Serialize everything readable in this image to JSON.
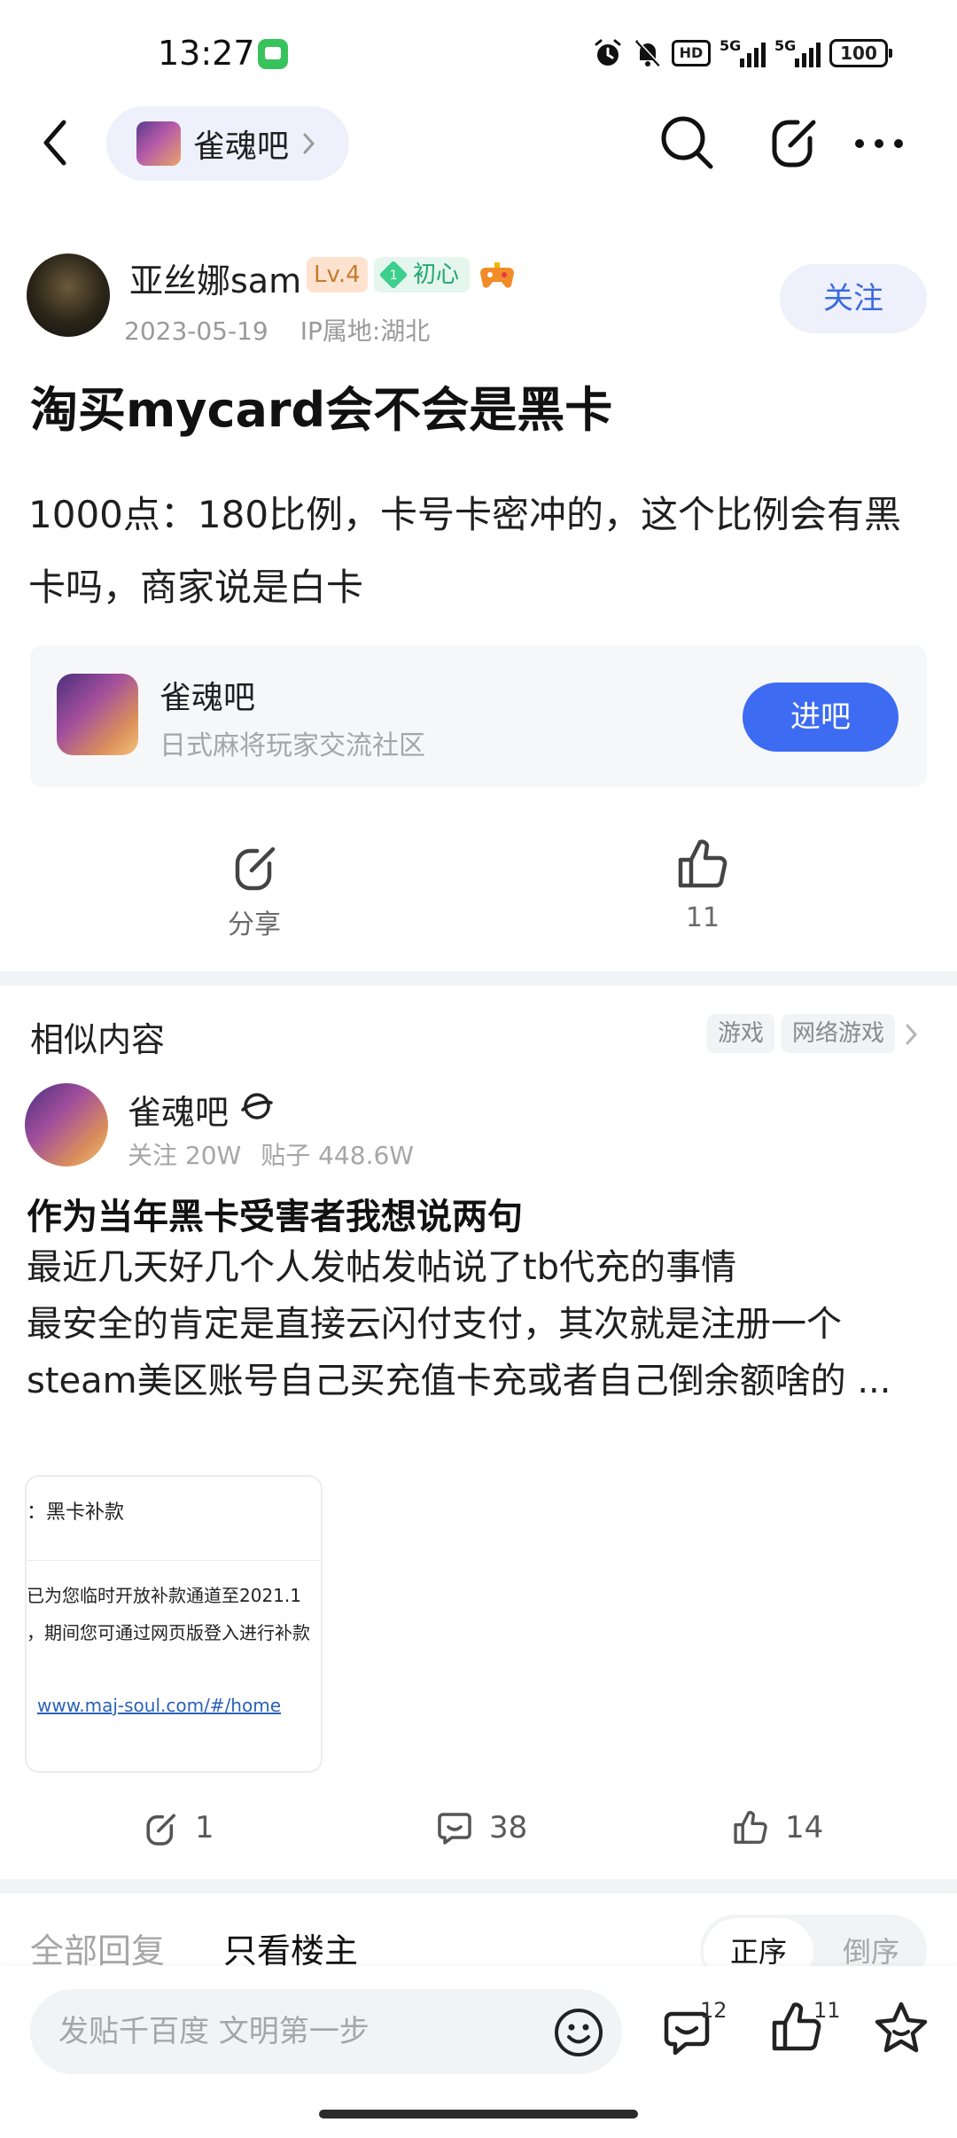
{
  "status_bar": {
    "time": "13:27",
    "hd_label": "HD",
    "net1_label": "5G",
    "net2_label": "5G",
    "battery": "100"
  },
  "nav": {
    "forum_name": "雀魂吧",
    "icons": [
      "back-icon",
      "search-icon",
      "edit-icon",
      "more-icon"
    ]
  },
  "post": {
    "author_name": "亚丝娜sam",
    "level": "Lv.4",
    "rank_number": "1",
    "rank_title": "初心",
    "date": "2023-05-19",
    "ip_location": "IP属地:湖北",
    "follow_label": "关注",
    "title": "淘买mycard会不会是黑卡",
    "body": "1000点：180比例，卡号卡密冲的，这个比例会有黑卡吗，商家说是白卡"
  },
  "forum_card": {
    "name": "雀魂吧",
    "description": "日式麻将玩家交流社区",
    "enter_label": "进吧"
  },
  "post_actions": {
    "share_label": "分享",
    "like_count": "11"
  },
  "similar": {
    "section_title": "相似内容",
    "tags": [
      "游戏",
      "网络游戏"
    ],
    "forum_name": "雀魂吧",
    "followers": "关注 20W",
    "posts": "贴子 448.6W",
    "title": "作为当年黑卡受害者我想说两句",
    "body": "最近几天好几个人发帖发帖说了tb代充的事情\n最安全的肯定是直接云闪付支付，其次就是注册一个steam美区账号自己买充值卡充或者自己倒余额啥的 ...",
    "thumb_line1": "：黑卡补款",
    "thumb_line2": "已为您临时开放补款通道至2021.1",
    "thumb_line3": "，期间您可通过网页版登入进行补款",
    "thumb_link": "www.maj-soul.com/#/home",
    "share_count": "1",
    "comment_count": "38",
    "like_count": "14"
  },
  "reply_tabs": {
    "all_label": "全部回复",
    "owner_label": "只看楼主",
    "sort_asc": "正序",
    "sort_desc": "倒序"
  },
  "bottom_bar": {
    "placeholder": "发贴千百度 文明第一步",
    "comment_count": "12",
    "like_count": "11"
  },
  "colors": {
    "accent": "#3d6cf2",
    "follow_text": "#3c6ae0",
    "muted": "#a6a6a6"
  }
}
